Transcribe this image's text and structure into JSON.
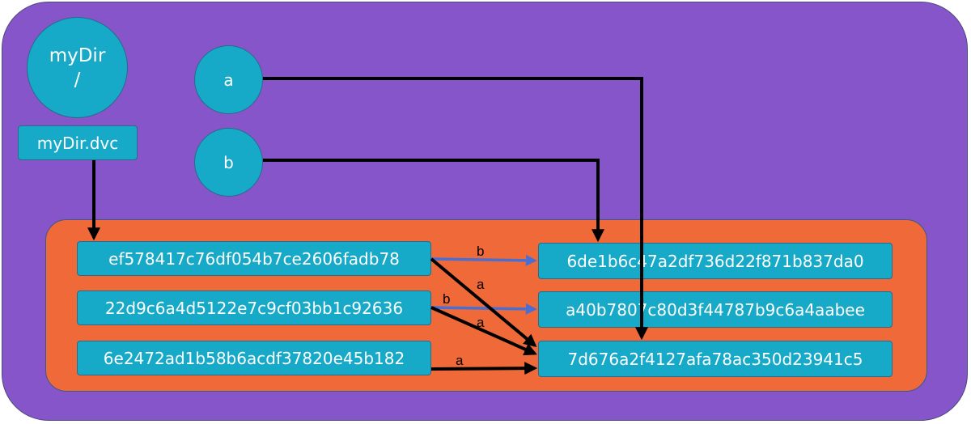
{
  "directory": {
    "name": "myDir",
    "suffix": "/"
  },
  "files": {
    "a": "a",
    "b": "b"
  },
  "dvc_file": "myDir.dvc",
  "cache_left": [
    "ef578417c76df054b7ce2606fadb78",
    "22d9c6a4d5122e7c9cf03bb1c92636",
    "6e2472ad1b58b6acdf37820e45b182"
  ],
  "cache_right": [
    "6de1b6c47a2df736d22f871b837da0",
    "a40b7807c80d3f44787b9c6a4aabee",
    "7d676a2f4127afa78ac350d23941c5"
  ],
  "edge_labels": {
    "b1": "b",
    "a1": "a",
    "b2": "b",
    "a2": "a",
    "a3": "a"
  },
  "colors": {
    "outer": "#8655c9",
    "store": "#f06938",
    "node": "#17a9c8",
    "blue_arrow": "#4a6fd0",
    "black_arrow": "#000000"
  }
}
